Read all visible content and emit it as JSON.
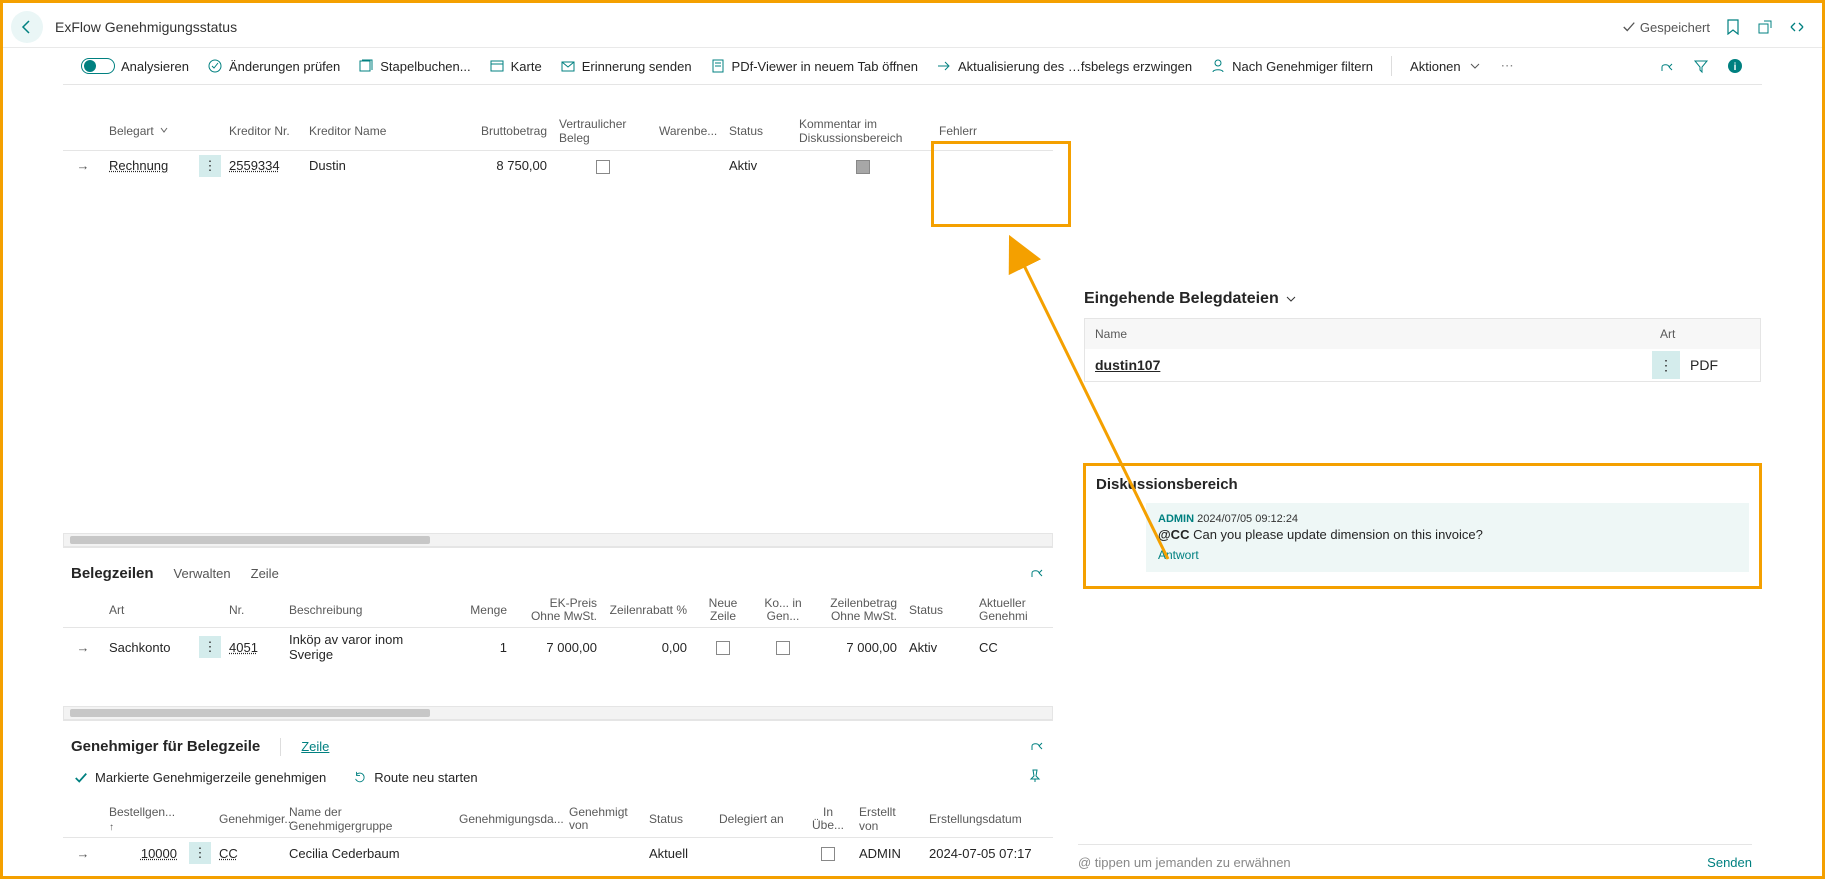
{
  "header": {
    "title": "ExFlow Genehmigungsstatus",
    "saved": "Gespeichert"
  },
  "toolbar": {
    "analyze": "Analysieren",
    "check": "Änderungen prüfen",
    "batch": "Stapelbuchen...",
    "card": "Karte",
    "reminder": "Erinnerung senden",
    "pdf": "PDf-Viewer in neuem Tab öffnen",
    "refresh": "Aktualisierung des …fsbelegs erzwingen",
    "filter_approver": "Nach Genehmiger filtern",
    "actions": "Aktionen"
  },
  "grid1": {
    "headers": {
      "belegart": "Belegart",
      "kreditor_nr": "Kreditor Nr.",
      "kreditor_name": "Kreditor Name",
      "brutto": "Bruttobetrag",
      "vertraulich": "Vertraulicher Beleg",
      "warenbe": "Warenbe...",
      "status": "Status",
      "kommentar": "Kommentar im Diskussionsbereich",
      "fehler": "Fehlerr"
    },
    "row": {
      "belegart": "Rechnung",
      "kreditor_nr": "2559334",
      "kreditor_name": "Dustin",
      "brutto": "8 750,00",
      "status": "Aktiv"
    }
  },
  "section2": {
    "title": "Belegzeilen",
    "tabs": {
      "verwalten": "Verwalten",
      "zeile": "Zeile"
    },
    "headers": {
      "art": "Art",
      "nr": "Nr.",
      "beschreibung": "Beschreibung",
      "menge": "Menge",
      "ek": "EK-Preis Ohne MwSt.",
      "rabatt": "Zeilenrabatt %",
      "neue": "Neue Zeile",
      "kogen": "Ko... in Gen...",
      "betrag": "Zeilenbetrag Ohne MwSt.",
      "status": "Status",
      "genehmi": "Aktueller Genehmi"
    },
    "row": {
      "art": "Sachkonto",
      "nr": "4051",
      "beschreibung": "Inköp av varor inom Sverige",
      "menge": "1",
      "ek": "7 000,00",
      "rabatt": "0,00",
      "betrag": "7 000,00",
      "status": "Aktiv",
      "genehmi": "CC"
    }
  },
  "section3": {
    "title": "Genehmiger für Belegzeile",
    "tab": "Zeile",
    "actions": {
      "approve": "Markierte Genehmigerzeile genehmigen",
      "restart": "Route neu starten"
    },
    "headers": {
      "bestell": "Bestellgen...",
      "genehmiger": "Genehmiger...",
      "gruppe": "Name der Genehmigergruppe",
      "gdatum": "Genehmigungsda...",
      "gvon": "Genehmigt von",
      "status": "Status",
      "delegiert": "Delegiert an",
      "inube": "In Übe...",
      "erstellt_von": "Erstellt von",
      "erstell_datum": "Erstellungsdatum"
    },
    "row": {
      "bestell": "10000",
      "genehmiger": "CC",
      "gruppe": "Cecilia Cederbaum",
      "status": "Aktuell",
      "erstellt_von": "ADMIN",
      "erstell_datum": "2024-07-05 07:17"
    }
  },
  "side": {
    "files_title": "Eingehende Belegdateien",
    "files_headers": {
      "name": "Name",
      "art": "Art"
    },
    "files_row": {
      "name": "dustin107",
      "art": "PDF"
    },
    "disc_title": "Diskussionsbereich",
    "comment": {
      "author": "ADMIN",
      "time": "2024/07/05 09:12:24",
      "at": "@CC",
      "body": "Can you please update dimension on this invoice?",
      "reply": "Antwort"
    }
  },
  "footer": {
    "placeholder": "@ tippen um jemanden zu erwähnen",
    "send": "Senden"
  }
}
